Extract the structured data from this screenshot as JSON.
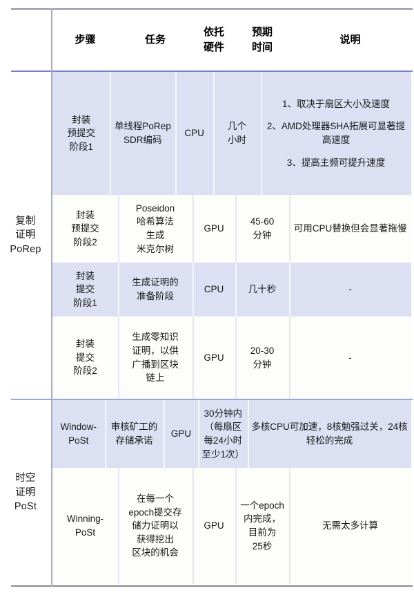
{
  "table": {
    "columns": [
      {
        "key": "step",
        "label_lines": [
          "步骤"
        ]
      },
      {
        "key": "task",
        "label_lines": [
          "任务"
        ]
      },
      {
        "key": "hw",
        "label_lines": [
          "依托",
          "硬件"
        ]
      },
      {
        "key": "time",
        "label_lines": [
          "预期",
          "时间"
        ]
      },
      {
        "key": "desc",
        "label_lines": [
          "说明"
        ]
      }
    ],
    "sections": [
      {
        "id": "porep",
        "group_label_lines": [
          "复制",
          "证明",
          "PoRep"
        ],
        "rows": [
          {
            "shaded": true,
            "step_lines": [
              "封装",
              "预提交",
              "阶段1"
            ],
            "task_lines": [
              "单线程PoRep",
              "SDR编码"
            ],
            "hw": "CPU",
            "time_lines": [
              "几个",
              "小时"
            ],
            "desc_paras": [
              "1、取决于扇区大小及速度",
              "2、AMD处理器SHA拓展可显著提高速度",
              "3、提高主频可提升速度"
            ]
          },
          {
            "shaded": false,
            "step_lines": [
              "封装",
              "预提交",
              "阶段2"
            ],
            "task_lines": [
              "Poseidon",
              "哈希算法",
              "生成",
              "米克尔树"
            ],
            "hw": "GPU",
            "time_lines": [
              "45-60",
              "分钟"
            ],
            "desc_paras": [
              "可用CPU替换但会显著拖慢"
            ]
          },
          {
            "shaded": true,
            "step_lines": [
              "封装",
              "提交",
              "阶段1"
            ],
            "task_lines": [
              "生成证明的",
              "准备阶段"
            ],
            "hw": "CPU",
            "time_lines": [
              "几十秒"
            ],
            "desc_paras": [
              "-"
            ]
          },
          {
            "shaded": false,
            "step_lines": [
              "封装",
              "提交",
              "阶段2"
            ],
            "task_lines": [
              "生成零知识",
              "证明，以供",
              "广播到区块",
              "链上"
            ],
            "hw": "GPU",
            "time_lines": [
              "20-30",
              "分钟"
            ],
            "desc_paras": [
              "-"
            ]
          }
        ]
      },
      {
        "id": "post",
        "group_label_lines": [
          "时空",
          "证明",
          "PoSt"
        ],
        "rows": [
          {
            "shaded": true,
            "step_lines": [
              "Window-",
              "PoSt"
            ],
            "task_lines": [
              "审核矿工的",
              "存储承诺"
            ],
            "hw": "GPU",
            "time_lines": [
              "30分钟内",
              "（每扇区",
              "每24小时",
              "至少1次）"
            ],
            "desc_paras": [
              "多核CPU可加速，8核勉强过关，24核轻松的完成"
            ]
          },
          {
            "shaded": false,
            "step_lines": [
              "Winning-",
              "PoSt"
            ],
            "task_lines": [
              "在每一个",
              "epoch提交存",
              "储力证明以",
              "获得挖出",
              "区块的机会"
            ],
            "hw": "GPU",
            "time_lines": [
              "一个epoch",
              "内完成，",
              "目前为",
              "25秒"
            ],
            "desc_paras": [
              "无需太多计算"
            ]
          }
        ]
      }
    ]
  },
  "colors": {
    "shaded_row": "#dce0f2",
    "plain_row": "#fdfdfa",
    "header_rule": "#7b82c4",
    "section_rule": "#9ba6df",
    "outer_rule": "#8b8b8b",
    "group_divider": "#a9a8cf",
    "text": "#161616"
  }
}
